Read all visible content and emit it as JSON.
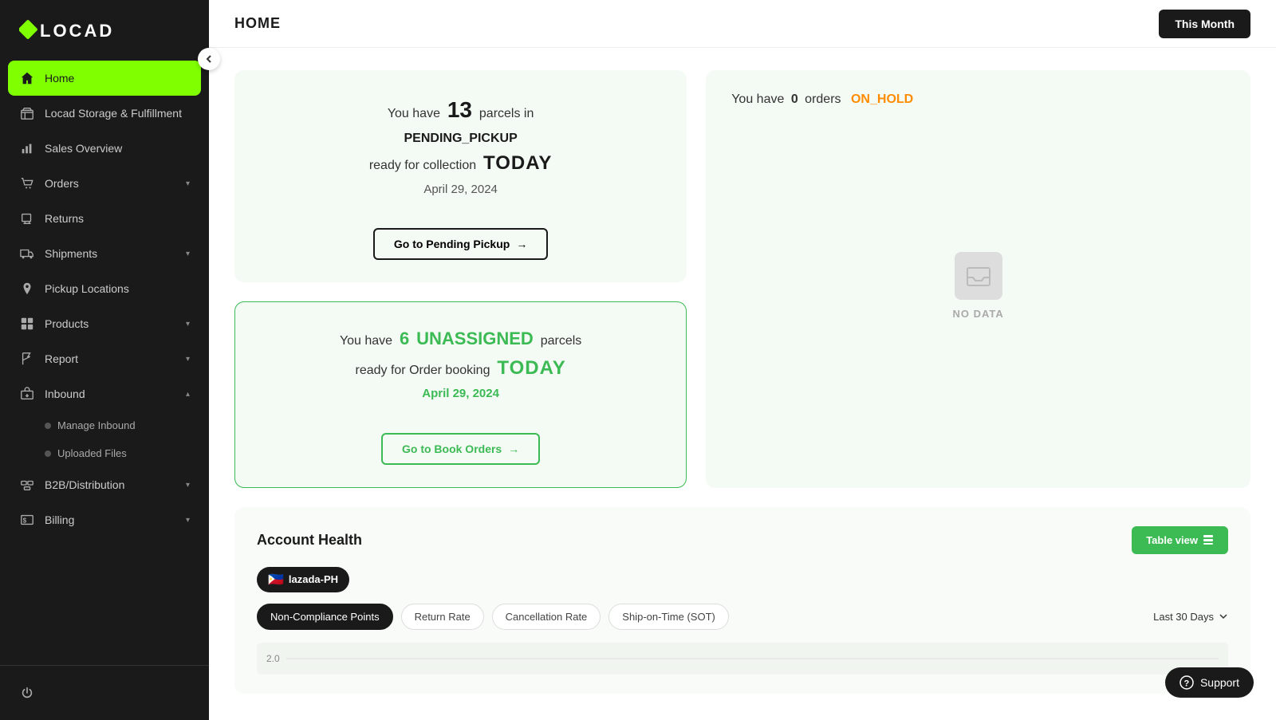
{
  "sidebar": {
    "logo": "LOCAD",
    "items": [
      {
        "id": "home",
        "label": "Home",
        "icon": "home",
        "active": true,
        "hasChevron": false
      },
      {
        "id": "storage",
        "label": "Locad Storage & Fulfillment",
        "icon": "box",
        "active": false,
        "hasChevron": false
      },
      {
        "id": "sales",
        "label": "Sales Overview",
        "icon": "chart",
        "active": false,
        "hasChevron": false
      },
      {
        "id": "orders",
        "label": "Orders",
        "icon": "cart",
        "active": false,
        "hasChevron": true
      },
      {
        "id": "returns",
        "label": "Returns",
        "icon": "return",
        "active": false,
        "hasChevron": false
      },
      {
        "id": "shipments",
        "label": "Shipments",
        "icon": "truck",
        "active": false,
        "hasChevron": true
      },
      {
        "id": "pickup",
        "label": "Pickup Locations",
        "icon": "pin",
        "active": false,
        "hasChevron": false
      },
      {
        "id": "products",
        "label": "Products",
        "icon": "products",
        "active": false,
        "hasChevron": true
      },
      {
        "id": "report",
        "label": "Report",
        "icon": "flag",
        "active": false,
        "hasChevron": true
      },
      {
        "id": "inbound",
        "label": "Inbound",
        "icon": "inbound",
        "active": false,
        "hasChevron": true,
        "expanded": true
      },
      {
        "id": "b2b",
        "label": "B2B/Distribution",
        "icon": "b2b",
        "active": false,
        "hasChevron": true
      },
      {
        "id": "billing",
        "label": "Billing",
        "icon": "billing",
        "active": false,
        "hasChevron": true
      }
    ],
    "subItems": [
      {
        "id": "manage-inbound",
        "label": "Manage Inbound",
        "parent": "inbound"
      },
      {
        "id": "uploaded-files",
        "label": "Uploaded Files",
        "parent": "inbound"
      }
    ]
  },
  "topbar": {
    "title": "HOME",
    "this_month_label": "This Month"
  },
  "pending_card": {
    "prefix": "You have",
    "count": "13",
    "suffix": "parcels in",
    "status": "PENDING_PICKUP",
    "ready_text": "ready for collection",
    "today": "TODAY",
    "date": "April 29, 2024",
    "button_label": "Go to Pending Pickup",
    "arrow": "→"
  },
  "unassigned_card": {
    "prefix": "You have",
    "count": "6",
    "status": "UNASSIGNED",
    "suffix": "parcels",
    "ready_text": "ready for Order booking",
    "today": "TODAY",
    "date": "April 29, 2024",
    "button_label": "Go to Book Orders",
    "arrow": "→"
  },
  "on_hold_card": {
    "prefix": "You have",
    "count": "0",
    "suffix": "orders",
    "status": "ON_HOLD",
    "no_data": "NO DATA"
  },
  "account_health": {
    "title": "Account Health",
    "table_view_label": "Table view",
    "platform_label": "lazada-PH",
    "platform_flag": "🇵🇭",
    "tabs": [
      {
        "id": "non-compliance",
        "label": "Non-Compliance Points",
        "active": true
      },
      {
        "id": "return-rate",
        "label": "Return Rate",
        "active": false
      },
      {
        "id": "cancellation-rate",
        "label": "Cancellation Rate",
        "active": false
      },
      {
        "id": "ship-on-time",
        "label": "Ship-on-Time (SOT)",
        "active": false
      }
    ],
    "date_range": "Last 30 Days",
    "chart_y_label": "2.0"
  },
  "support": {
    "label": "Support"
  }
}
